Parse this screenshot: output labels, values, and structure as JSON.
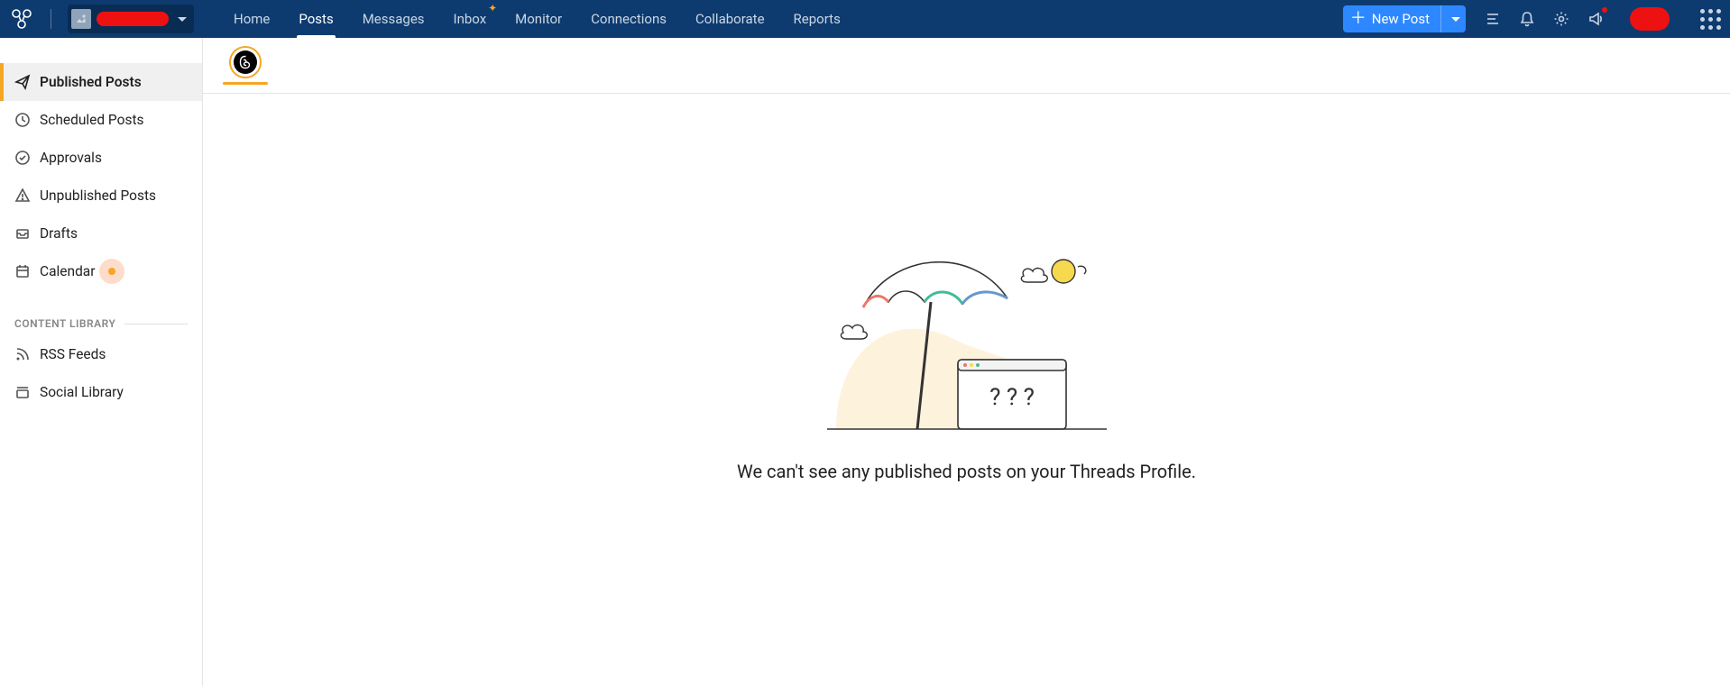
{
  "header": {
    "nav": {
      "home": "Home",
      "posts": "Posts",
      "messages": "Messages",
      "inbox": "Inbox",
      "monitor": "Monitor",
      "connections": "Connections",
      "collaborate": "Collaborate",
      "reports": "Reports"
    },
    "new_post_label": "New Post"
  },
  "sidebar": {
    "items": {
      "published": "Published Posts",
      "scheduled": "Scheduled Posts",
      "approvals": "Approvals",
      "unpublished": "Unpublished Posts",
      "drafts": "Drafts",
      "calendar": "Calendar"
    },
    "section_label": "CONTENT LIBRARY",
    "library": {
      "rss": "RSS Feeds",
      "social": "Social Library"
    }
  },
  "content": {
    "empty_message": "We can't see any published posts on your Threads Profile."
  }
}
